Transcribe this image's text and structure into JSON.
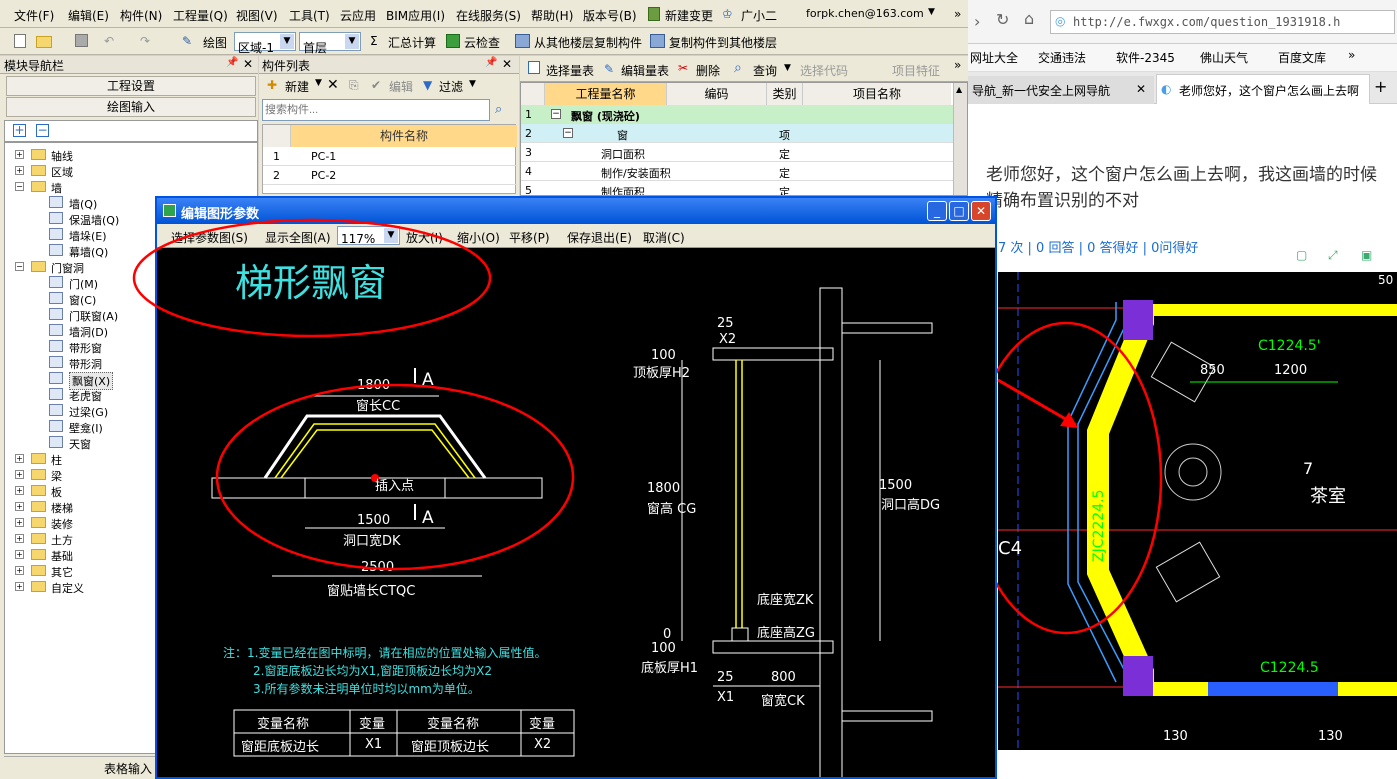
{
  "menubar": {
    "items": [
      "文件(F)",
      "编辑(E)",
      "构件(N)",
      "工程量(Q)",
      "视图(V)",
      "工具(T)",
      "云应用",
      "BIM应用(I)",
      "在线服务(S)",
      "帮助(H)",
      "版本号(B)",
      "新建变更",
      "广小二"
    ],
    "account": "forpk.chen@163.com"
  },
  "toolbar": {
    "draw_label": "绘图",
    "area_value": "区域-1",
    "floor_value": "首层",
    "sum_calc": "汇总计算",
    "cloud_check": "云检查",
    "copy_from": "从其他楼层复制构件",
    "copy_to": "复制构件到其他楼层"
  },
  "nav": {
    "title": "模块导航栏",
    "project_settings": "工程设置",
    "draw_input": "绘图输入",
    "table_input": "表格输入",
    "tree": [
      {
        "label": "轴线",
        "level": 0,
        "expanded": false
      },
      {
        "label": "区域",
        "level": 0,
        "expanded": false
      },
      {
        "label": "墙",
        "level": 0,
        "expanded": true
      },
      {
        "label": "墙(Q)",
        "level": 1
      },
      {
        "label": "保温墙(Q)",
        "level": 1
      },
      {
        "label": "墙垛(E)",
        "level": 1
      },
      {
        "label": "幕墙(Q)",
        "level": 1
      },
      {
        "label": "门窗洞",
        "level": 0,
        "expanded": true
      },
      {
        "label": "门(M)",
        "level": 1
      },
      {
        "label": "窗(C)",
        "level": 1
      },
      {
        "label": "门联窗(A)",
        "level": 1
      },
      {
        "label": "墙洞(D)",
        "level": 1
      },
      {
        "label": "带形窗",
        "level": 1
      },
      {
        "label": "带形洞",
        "level": 1
      },
      {
        "label": "飘窗(X)",
        "level": 1,
        "selected": true
      },
      {
        "label": "老虎窗",
        "level": 1
      },
      {
        "label": "过梁(G)",
        "level": 1
      },
      {
        "label": "壁龛(I)",
        "level": 1
      },
      {
        "label": "天窗",
        "level": 1
      },
      {
        "label": "柱",
        "level": 0,
        "expanded": false
      },
      {
        "label": "梁",
        "level": 0,
        "expanded": false
      },
      {
        "label": "板",
        "level": 0,
        "expanded": false
      },
      {
        "label": "楼梯",
        "level": 0,
        "expanded": false
      },
      {
        "label": "装修",
        "level": 0,
        "expanded": false
      },
      {
        "label": "土方",
        "level": 0,
        "expanded": false
      },
      {
        "label": "基础",
        "level": 0,
        "expanded": false
      },
      {
        "label": "其它",
        "level": 0,
        "expanded": false
      },
      {
        "label": "自定义",
        "level": 0,
        "expanded": false
      }
    ]
  },
  "complist": {
    "title": "构件列表",
    "new_btn": "新建",
    "edit_btn": "编辑",
    "filter_btn": "过滤",
    "search_placeholder": "搜索构件...",
    "header": "构件名称",
    "rows": [
      {
        "n": "1",
        "name": "PC-1"
      },
      {
        "n": "2",
        "name": "PC-2"
      }
    ]
  },
  "qtable": {
    "buttons": [
      "选择量表",
      "编辑量表",
      "删除",
      "查询",
      "选择代码",
      "项目特征"
    ],
    "headers": [
      "工程量名称",
      "编码",
      "类别",
      "项目名称"
    ],
    "rows": [
      {
        "n": "1",
        "name": "飘窗 (现浇砼)",
        "code": "",
        "type": ""
      },
      {
        "n": "2",
        "name": "窗",
        "code": "",
        "type": "项"
      },
      {
        "n": "3",
        "name": "洞口面积",
        "code": "",
        "type": "定"
      },
      {
        "n": "4",
        "name": "制作/安装面积",
        "code": "",
        "type": "定"
      },
      {
        "n": "5",
        "name": "制作面积",
        "code": "",
        "type": "定"
      }
    ]
  },
  "dialog": {
    "title": "编辑图形参数",
    "tools": [
      "选择参数图(S)",
      "显示全图(A)",
      "放大(I)",
      "缩小(O)",
      "平移(P)",
      "保存退出(E)",
      "取消(C)"
    ],
    "zoom": "117%",
    "heading": "梯形飘窗",
    "labels": {
      "cc_val": "1800",
      "cc": "窗长CC",
      "insert": "插入点",
      "dk_val": "1500",
      "dk": "洞口宽DK",
      "ctqc_val": "2500",
      "ctqc": "窗贴墙长CTQC",
      "a1": "A",
      "a2": "A",
      "x2_val": "25",
      "x2": "X2",
      "h2_val": "100",
      "h2": "顶板厚H2",
      "cg_val": "1800",
      "cg": "窗高 CG",
      "dg_val": "1500",
      "dg": "洞口高DG",
      "zk": "底座宽ZK",
      "zg": "底座高ZG",
      "h1_val": "100",
      "h1": "底板厚H1",
      "x1_val": "25",
      "x1": "X1",
      "ck_val": "800",
      "ck": "窗宽CK",
      "zero": "0"
    },
    "notes": [
      "注：1.变量已经在图中标明，请在相应的位置处输入属性值。",
      "2.窗距底板边长均为X1,窗距顶板边长均为X2",
      "3.所有参数未注明单位时均以mm为单位。"
    ],
    "table": {
      "h": [
        "变量名称",
        "变量",
        "变量名称",
        "变量"
      ],
      "r": [
        "窗距底板边长",
        "X1",
        "窗距顶板边长",
        "X2"
      ]
    }
  },
  "browser": {
    "url": "http://e.fwxgx.com/question_1931918.h",
    "bookmarks": [
      "网址大全",
      "交通违法",
      "软件-2345",
      "佛山天气",
      "百度文库"
    ],
    "tabs": [
      "导航_新一代安全上网导航",
      "老师您好，这个窗户怎么画上去啊"
    ],
    "question": "老师您好，这个窗户怎么画上去啊，我这画墙的时候",
    "question2": "精确布置识别的不对",
    "stats": "7 次 | 0 回答 | 0 答得好 | 0问得好",
    "cad": {
      "c_top": "C1224.5'",
      "c_bot": "C1224.5",
      "zjc": "ZJC2224.5",
      "d850": "850",
      "d1200": "1200",
      "room_no": "7",
      "room": "茶室",
      "c4": "C4",
      "d130a": "130",
      "d130b": "130",
      "d50": "50"
    }
  },
  "colors": {
    "xp_blue": "#0054e3",
    "cad_yellow": "#ffff00",
    "cad_cyan": "#00ffff",
    "red_annot": "#ff0000"
  }
}
